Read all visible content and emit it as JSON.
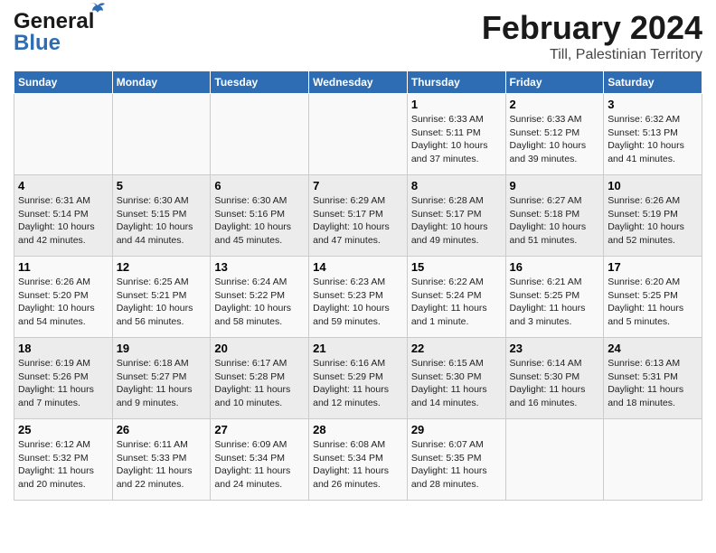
{
  "logo": {
    "line1": "General",
    "line2": "Blue"
  },
  "title": "February 2024",
  "subtitle": "Till, Palestinian Territory",
  "days_of_week": [
    "Sunday",
    "Monday",
    "Tuesday",
    "Wednesday",
    "Thursday",
    "Friday",
    "Saturday"
  ],
  "weeks": [
    [
      {
        "day": "",
        "info": ""
      },
      {
        "day": "",
        "info": ""
      },
      {
        "day": "",
        "info": ""
      },
      {
        "day": "",
        "info": ""
      },
      {
        "day": "1",
        "info": "Sunrise: 6:33 AM\nSunset: 5:11 PM\nDaylight: 10 hours and 37 minutes."
      },
      {
        "day": "2",
        "info": "Sunrise: 6:33 AM\nSunset: 5:12 PM\nDaylight: 10 hours and 39 minutes."
      },
      {
        "day": "3",
        "info": "Sunrise: 6:32 AM\nSunset: 5:13 PM\nDaylight: 10 hours and 41 minutes."
      }
    ],
    [
      {
        "day": "4",
        "info": "Sunrise: 6:31 AM\nSunset: 5:14 PM\nDaylight: 10 hours and 42 minutes."
      },
      {
        "day": "5",
        "info": "Sunrise: 6:30 AM\nSunset: 5:15 PM\nDaylight: 10 hours and 44 minutes."
      },
      {
        "day": "6",
        "info": "Sunrise: 6:30 AM\nSunset: 5:16 PM\nDaylight: 10 hours and 45 minutes."
      },
      {
        "day": "7",
        "info": "Sunrise: 6:29 AM\nSunset: 5:17 PM\nDaylight: 10 hours and 47 minutes."
      },
      {
        "day": "8",
        "info": "Sunrise: 6:28 AM\nSunset: 5:17 PM\nDaylight: 10 hours and 49 minutes."
      },
      {
        "day": "9",
        "info": "Sunrise: 6:27 AM\nSunset: 5:18 PM\nDaylight: 10 hours and 51 minutes."
      },
      {
        "day": "10",
        "info": "Sunrise: 6:26 AM\nSunset: 5:19 PM\nDaylight: 10 hours and 52 minutes."
      }
    ],
    [
      {
        "day": "11",
        "info": "Sunrise: 6:26 AM\nSunset: 5:20 PM\nDaylight: 10 hours and 54 minutes."
      },
      {
        "day": "12",
        "info": "Sunrise: 6:25 AM\nSunset: 5:21 PM\nDaylight: 10 hours and 56 minutes."
      },
      {
        "day": "13",
        "info": "Sunrise: 6:24 AM\nSunset: 5:22 PM\nDaylight: 10 hours and 58 minutes."
      },
      {
        "day": "14",
        "info": "Sunrise: 6:23 AM\nSunset: 5:23 PM\nDaylight: 10 hours and 59 minutes."
      },
      {
        "day": "15",
        "info": "Sunrise: 6:22 AM\nSunset: 5:24 PM\nDaylight: 11 hours and 1 minute."
      },
      {
        "day": "16",
        "info": "Sunrise: 6:21 AM\nSunset: 5:25 PM\nDaylight: 11 hours and 3 minutes."
      },
      {
        "day": "17",
        "info": "Sunrise: 6:20 AM\nSunset: 5:25 PM\nDaylight: 11 hours and 5 minutes."
      }
    ],
    [
      {
        "day": "18",
        "info": "Sunrise: 6:19 AM\nSunset: 5:26 PM\nDaylight: 11 hours and 7 minutes."
      },
      {
        "day": "19",
        "info": "Sunrise: 6:18 AM\nSunset: 5:27 PM\nDaylight: 11 hours and 9 minutes."
      },
      {
        "day": "20",
        "info": "Sunrise: 6:17 AM\nSunset: 5:28 PM\nDaylight: 11 hours and 10 minutes."
      },
      {
        "day": "21",
        "info": "Sunrise: 6:16 AM\nSunset: 5:29 PM\nDaylight: 11 hours and 12 minutes."
      },
      {
        "day": "22",
        "info": "Sunrise: 6:15 AM\nSunset: 5:30 PM\nDaylight: 11 hours and 14 minutes."
      },
      {
        "day": "23",
        "info": "Sunrise: 6:14 AM\nSunset: 5:30 PM\nDaylight: 11 hours and 16 minutes."
      },
      {
        "day": "24",
        "info": "Sunrise: 6:13 AM\nSunset: 5:31 PM\nDaylight: 11 hours and 18 minutes."
      }
    ],
    [
      {
        "day": "25",
        "info": "Sunrise: 6:12 AM\nSunset: 5:32 PM\nDaylight: 11 hours and 20 minutes."
      },
      {
        "day": "26",
        "info": "Sunrise: 6:11 AM\nSunset: 5:33 PM\nDaylight: 11 hours and 22 minutes."
      },
      {
        "day": "27",
        "info": "Sunrise: 6:09 AM\nSunset: 5:34 PM\nDaylight: 11 hours and 24 minutes."
      },
      {
        "day": "28",
        "info": "Sunrise: 6:08 AM\nSunset: 5:34 PM\nDaylight: 11 hours and 26 minutes."
      },
      {
        "day": "29",
        "info": "Sunrise: 6:07 AM\nSunset: 5:35 PM\nDaylight: 11 hours and 28 minutes."
      },
      {
        "day": "",
        "info": ""
      },
      {
        "day": "",
        "info": ""
      }
    ]
  ]
}
